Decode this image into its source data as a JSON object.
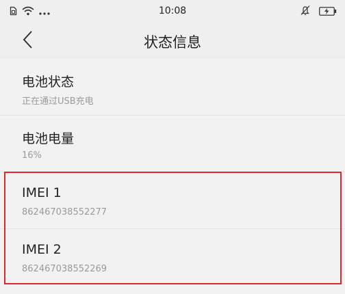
{
  "statusbar": {
    "time": "10:08",
    "icons_left": [
      "sim-icon",
      "wifi-icon",
      "more-dots-icon"
    ],
    "icons_right": [
      "mute-icon",
      "battery-charging-icon"
    ]
  },
  "navbar": {
    "title": "状态信息",
    "back_icon": "chevron-left-icon"
  },
  "items": [
    {
      "title": "电池状态",
      "subtitle": "正在通过USB充电"
    },
    {
      "title": "电池电量",
      "subtitle": "16%"
    },
    {
      "title": "IMEI 1",
      "subtitle": "862467038552277"
    },
    {
      "title": "IMEI 2",
      "subtitle": "862467038552269"
    }
  ],
  "colors": {
    "highlight_border": "#e0262a",
    "background": "#f2f2f2",
    "subtitle_text": "#9a9a9a"
  }
}
